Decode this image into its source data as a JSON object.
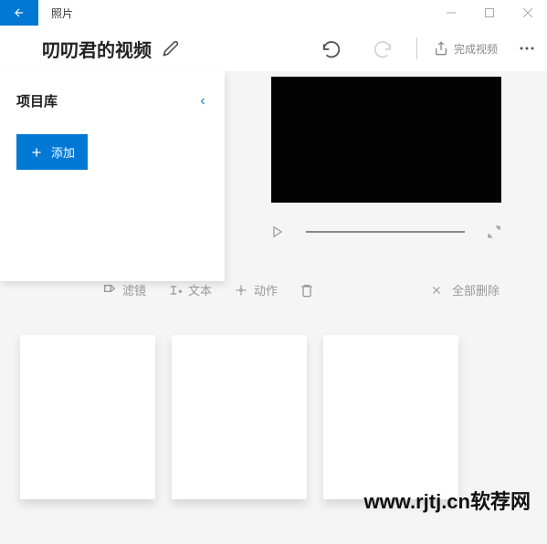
{
  "app": {
    "title": "照片"
  },
  "project": {
    "title": "叨叨君的视频"
  },
  "header": {
    "finish": "完成视频"
  },
  "library": {
    "title": "项目库",
    "add": "添加"
  },
  "toolbar": {
    "filter": "滤镜",
    "text": "文本",
    "motion": "动作",
    "deleteAll": "全部删除"
  },
  "watermark": "www.rjtj.cn软荐网"
}
